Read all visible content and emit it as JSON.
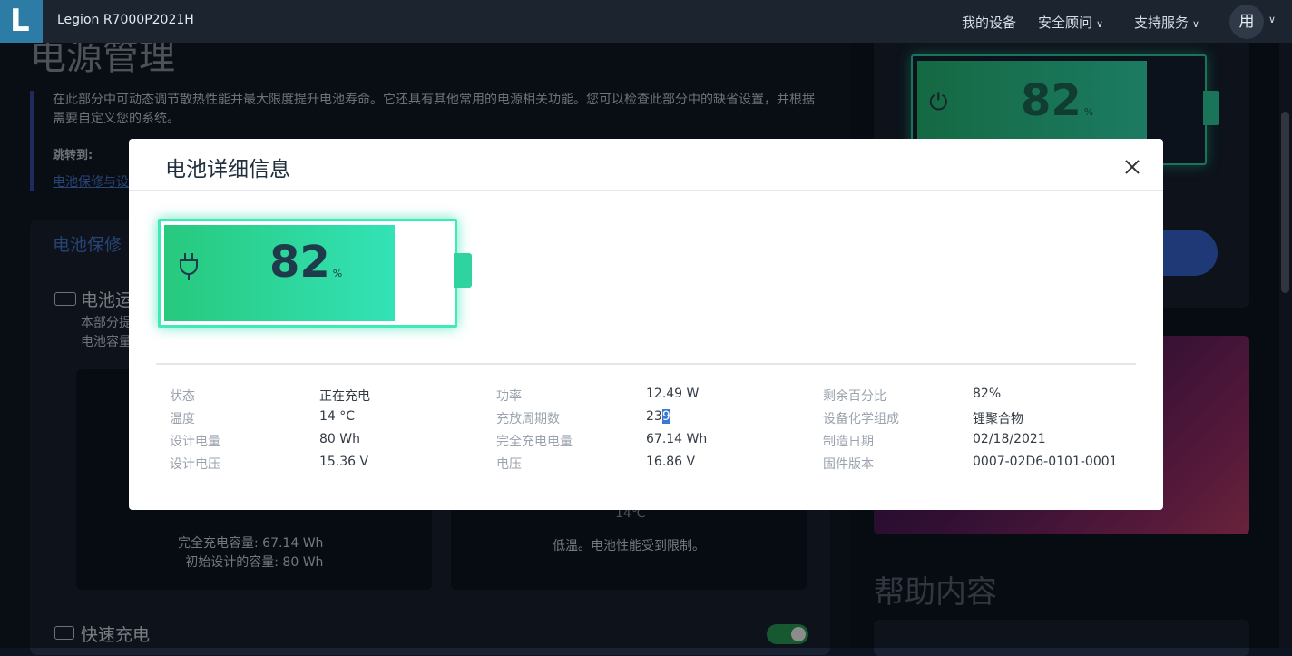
{
  "topbar": {
    "logo_letter": "L",
    "model_name": "Legion R7000P2021H",
    "nav": [
      "我的设备",
      "安全顾问",
      "支持服务"
    ],
    "user_initial": "用"
  },
  "background": {
    "page_title": "电源管理",
    "intro": "在此部分中可动态调节散热性能并最大限度提升电池寿命。它还具有其他常用的电源相关功能。您可以检查此部分中的缺省设置，并根据需要自定义您的系统。",
    "jump_label": "跳转到:",
    "jump_link": "电池保修与设",
    "section_title": "电池保修",
    "sub_title": "电池运",
    "sub_desc_line1": "本部分提",
    "sub_desc_line2": "电池容量",
    "full_capacity": "完全充电容量:  67.14 Wh",
    "design_capacity": "初始设计的容量:  80 Wh",
    "temp_value": "14℃",
    "temp_note": "低温。电池性能受到限制。",
    "fast_charge_label": "快速充电",
    "fast_charge_on": true,
    "mini_battery_percent": "82",
    "help_title": "帮助内容",
    "colors": {
      "accent": "#4a7bd6",
      "battery_green": "#2fd3a5",
      "toggle_on": "#2aa05a"
    }
  },
  "modal": {
    "title": "电池详细信息",
    "battery": {
      "percent_value": "82",
      "percent_unit": "%",
      "level_fraction": 0.82
    },
    "details": {
      "col1": [
        {
          "label": "状态",
          "value": "正在充电"
        },
        {
          "label": "温度",
          "value": "14 °C"
        },
        {
          "label": "设计电量",
          "value": "80 Wh"
        },
        {
          "label": "设计电压",
          "value": "15.36 V"
        }
      ],
      "col2": [
        {
          "label": "功率",
          "value": "12.49 W"
        },
        {
          "label": "充放周期数",
          "value_a": "23",
          "value_b": "9"
        },
        {
          "label": "完全充电电量",
          "value": "67.14 Wh"
        },
        {
          "label": "电压",
          "value": "16.86 V"
        }
      ],
      "col3": [
        {
          "label": "剩余百分比",
          "value": "82%"
        },
        {
          "label": "设备化学组成",
          "value": "锂聚合物"
        },
        {
          "label": "制造日期",
          "value": "02/18/2021"
        },
        {
          "label": "固件版本",
          "value": "0007-02D6-0101-0001"
        }
      ]
    }
  }
}
